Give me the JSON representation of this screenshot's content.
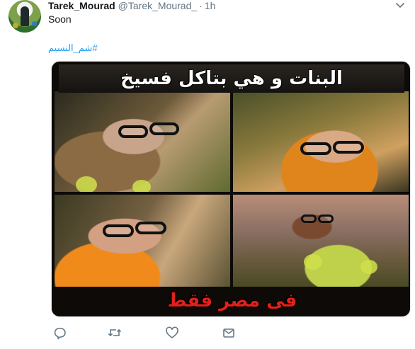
{
  "tweet": {
    "display_name": "Tarek_Mourad",
    "handle": "@Tarek_Mourad_",
    "separator": "·",
    "time": "1h",
    "text": "Soon",
    "hashtag": "#شم_النسيم"
  },
  "media": {
    "caption_top": "البنات و هي بتاكل فسيخ",
    "caption_bottom": "فى مصر فقط"
  },
  "icons": {
    "reply": "reply-icon",
    "retweet": "retweet-icon",
    "like": "heart-icon",
    "dm": "envelope-icon",
    "caret": "chevron-down-icon"
  },
  "colors": {
    "link": "#1da1f2",
    "muted": "#657786",
    "caption_bottom": "#e0211a"
  }
}
